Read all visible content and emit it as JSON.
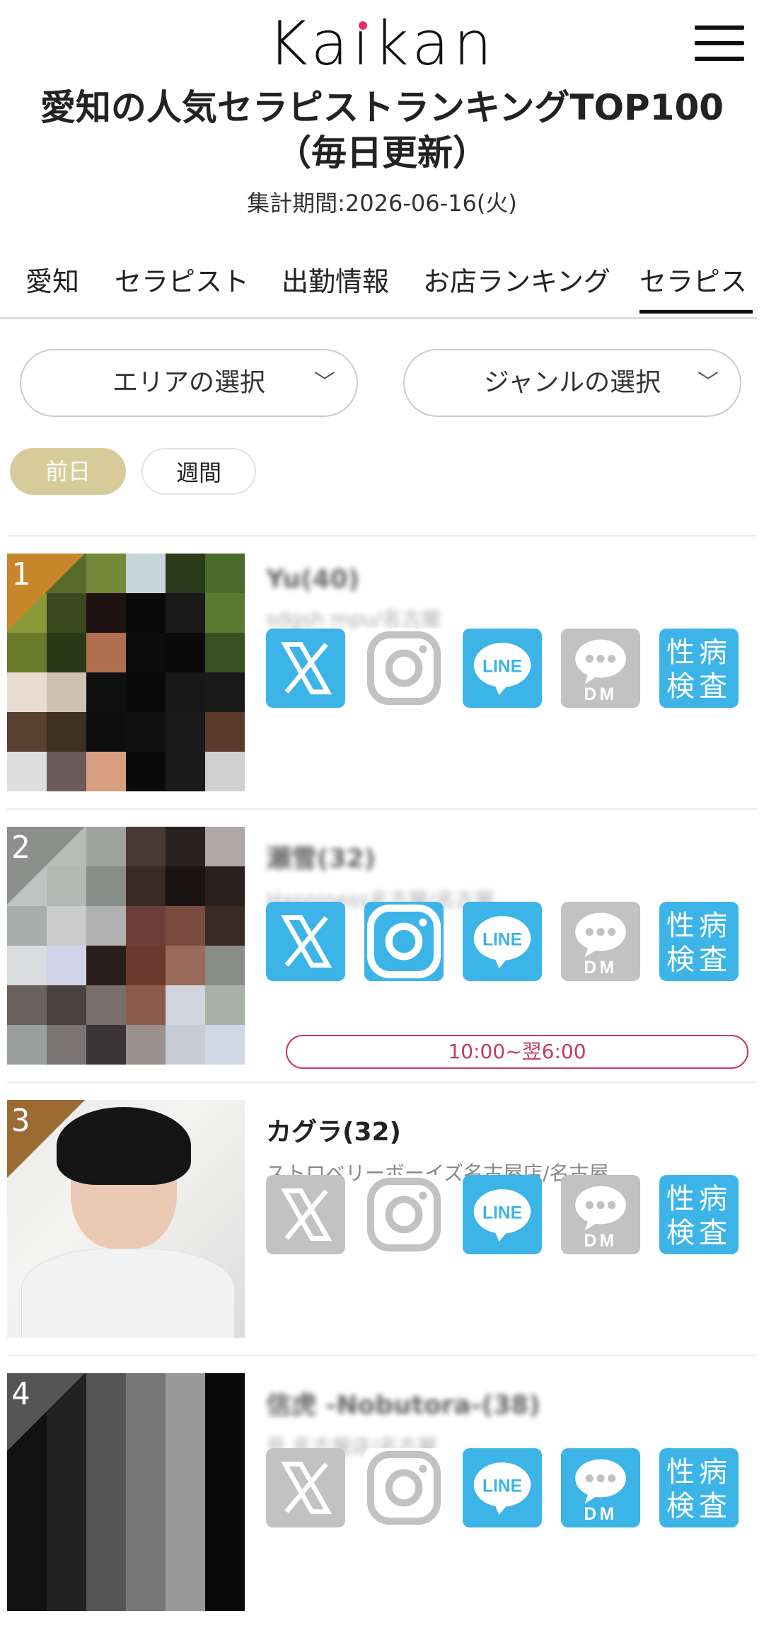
{
  "header": {
    "logo": "Kaikan",
    "menu": "menu"
  },
  "title": "愛知の人気セラピストランキングTOP100（毎日更新）",
  "period": "集計期間:2026-06-16(火)",
  "tabs": [
    "愛知",
    "セラピスト",
    "出勤情報",
    "お店ランキング",
    "セラピスト"
  ],
  "filters": {
    "area": "エリアの選択",
    "genre": "ジャンルの選択"
  },
  "period_toggle": {
    "day": "前日",
    "week": "週間"
  },
  "colors": {
    "accent_pill": "#d7cc99",
    "sns_blue": "#3cb4e8",
    "sns_gray": "#c2c2c2",
    "hours_red": "#c23a5a",
    "rank1": "#c8862a",
    "rank2": "#8d8f8c",
    "rank3": "#9c6b34",
    "rank4": "#555555"
  },
  "therapists": [
    {
      "rank": "1",
      "name": "Yu(40)",
      "shop": "sdgsh mpu/名古屋",
      "blurred": true,
      "icons": [
        "x-blue",
        "instagram-gray",
        "line-blue",
        "dm-gray",
        "test-blue"
      ],
      "hours": null
    },
    {
      "rank": "2",
      "name": "瀬雪(32)",
      "shop": "Happiness名古屋/名古屋",
      "blurred": true,
      "icons": [
        "x-blue",
        "instagram-blue",
        "line-blue",
        "dm-gray",
        "test-blue"
      ],
      "hours": "10:00~翌6:00"
    },
    {
      "rank": "3",
      "name": "カグラ(32)",
      "shop": "ストロベリーボーイズ名古屋店/名古屋",
      "blurred": false,
      "icons": [
        "x-gray",
        "instagram-gray",
        "line-blue",
        "dm-gray",
        "test-blue"
      ],
      "hours": null
    },
    {
      "rank": "4",
      "name": "信虎 -Nobutora-(38)",
      "shop": "号 名古屋店/名古屋",
      "blurred": true,
      "icons": [
        "x-gray",
        "instagram-gray",
        "line-blue",
        "dm-blue",
        "test-blue"
      ],
      "hours": null
    }
  ],
  "icon_labels": {
    "line": "LINE",
    "dm": "DM",
    "test": "性病検査"
  }
}
